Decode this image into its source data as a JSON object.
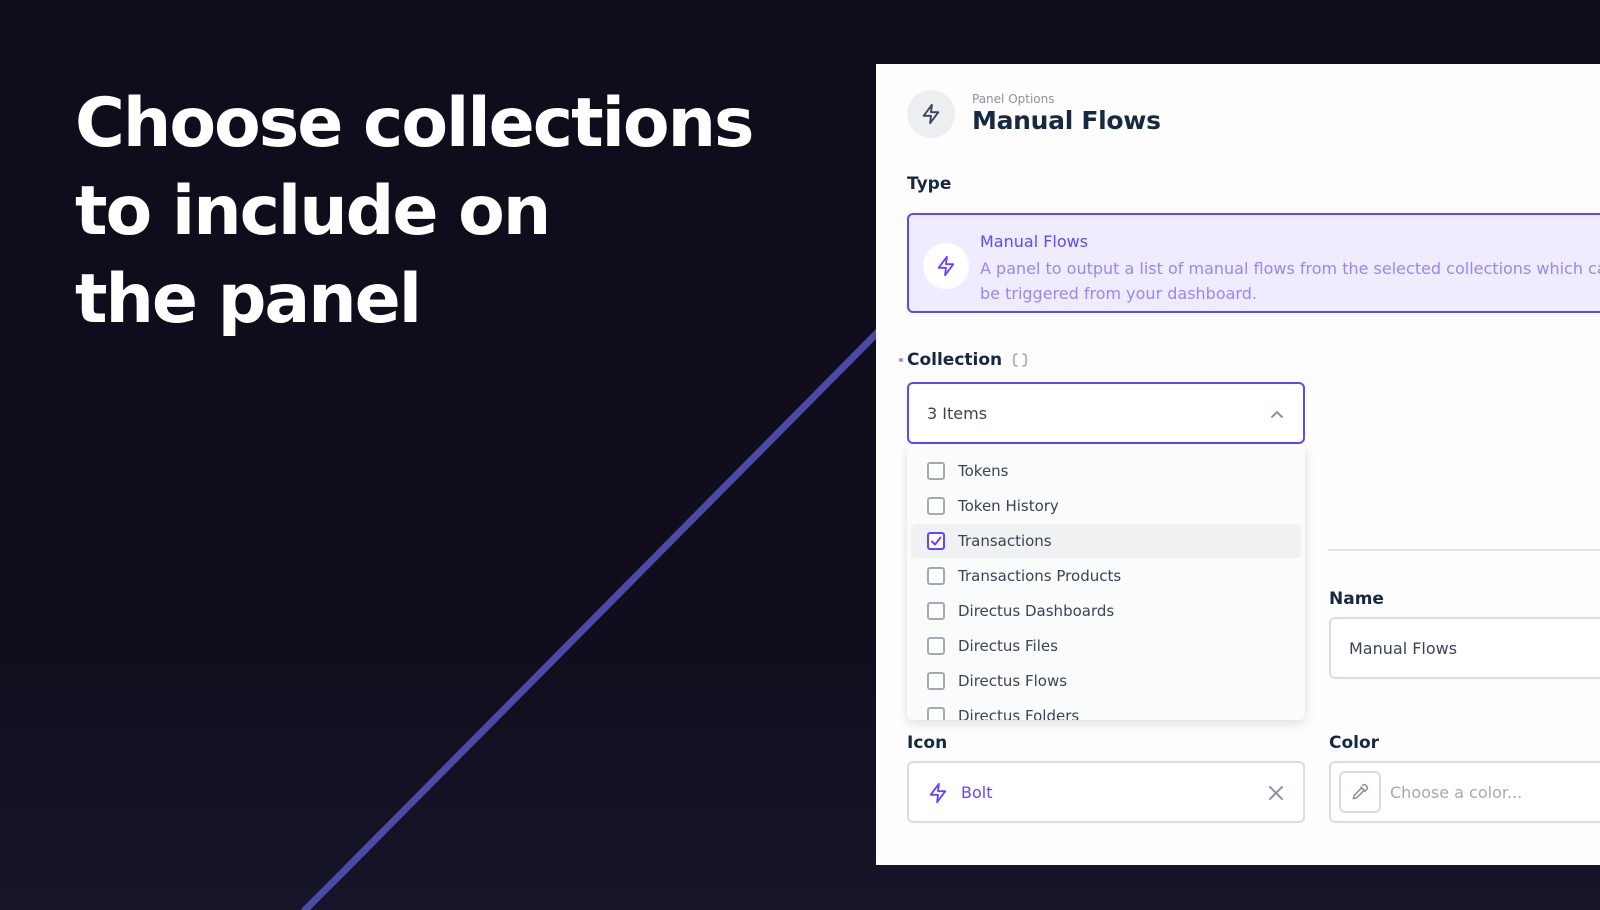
{
  "headline": {
    "lines": [
      "Choose collections",
      "to include on",
      "the panel"
    ]
  },
  "panel": {
    "eyebrow": "Panel Options",
    "title": "Manual Flows",
    "header_icon": "bolt-icon"
  },
  "type_field": {
    "label": "Type",
    "card_title": "Manual Flows",
    "card_description": "A panel to output a list of manual flows from the selected collections which can be triggered from your dashboard."
  },
  "collection_field": {
    "label": "Collection",
    "label_icon": "code-brackets-icon",
    "value": "3 Items",
    "options": [
      {
        "label": "Tokens",
        "checked": false
      },
      {
        "label": "Token History",
        "checked": false
      },
      {
        "label": "Transactions",
        "checked": true
      },
      {
        "label": "Transactions Products",
        "checked": false
      },
      {
        "label": "Directus Dashboards",
        "checked": false
      },
      {
        "label": "Directus Files",
        "checked": false
      },
      {
        "label": "Directus Flows",
        "checked": false
      },
      {
        "label": "Directus Folders",
        "checked": false
      }
    ]
  },
  "name_field": {
    "label": "Name",
    "value": "Manual Flows"
  },
  "icon_field": {
    "label": "Icon",
    "value": "Bolt"
  },
  "color_field": {
    "label": "Color",
    "placeholder": "Choose a color..."
  },
  "colors": {
    "accent": "#6644ff",
    "accent_soft": "#f0ecff",
    "background": "#110e1f",
    "diagonal_line": "#4b4aa6"
  }
}
